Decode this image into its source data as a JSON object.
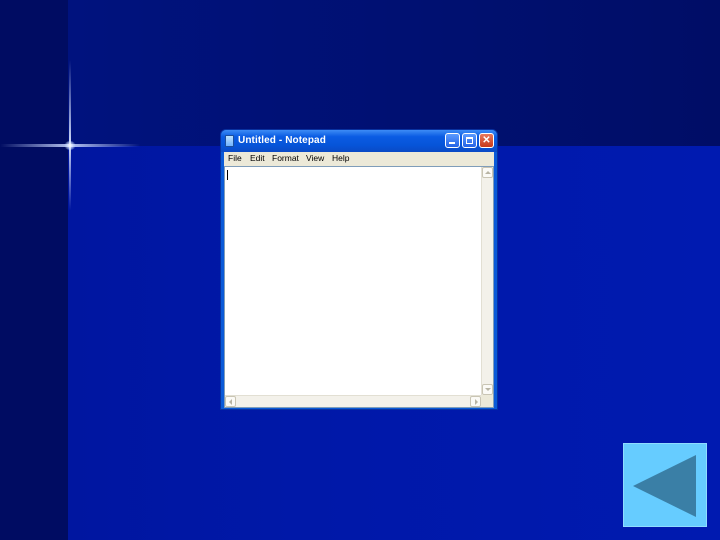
{
  "window": {
    "title": "Untitled - Notepad",
    "close_glyph": "✕"
  },
  "menu": {
    "items": [
      {
        "label": "File"
      },
      {
        "label": "Edit"
      },
      {
        "label": "Format"
      },
      {
        "label": "View"
      },
      {
        "label": "Help"
      }
    ]
  },
  "editor": {
    "content": ""
  },
  "icons": {
    "window_icon": "notepad-icon",
    "back": "back-arrow-icon"
  },
  "colors": {
    "background": "#0018a8",
    "titlebar": "#0654d8",
    "back_button": "#66ccff",
    "back_arrow": "#3a7fa6"
  }
}
